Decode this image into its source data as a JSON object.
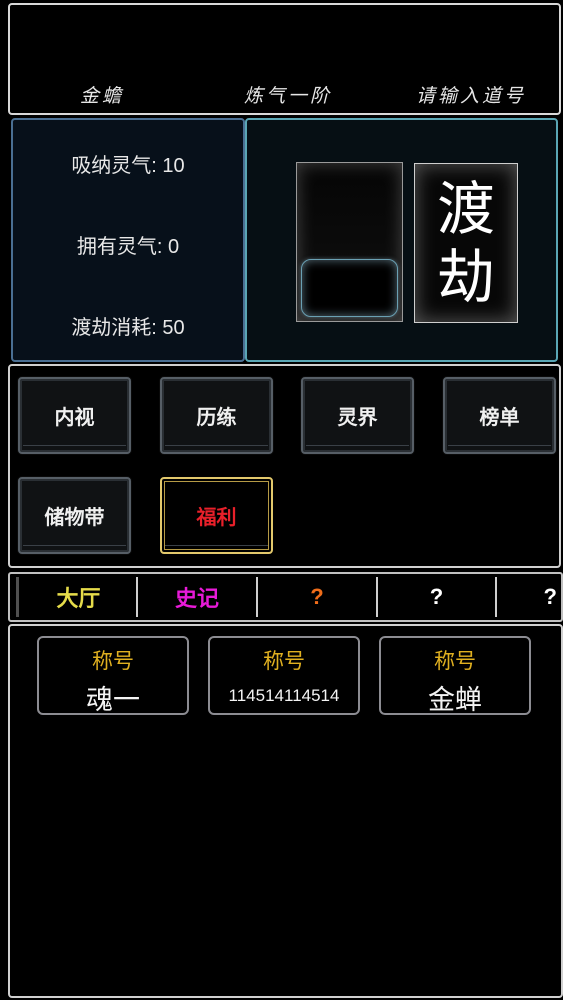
{
  "header": {
    "name": "金蟾",
    "realm": "炼气一阶",
    "dao_id": "请输入道号"
  },
  "stats": {
    "absorb": "吸纳灵气: 10",
    "owned": "拥有灵气: 0",
    "tribulation_cost": "渡劫消耗: 50"
  },
  "tribulation": {
    "progress": 0.42,
    "button_char1": "渡",
    "button_char2": "劫"
  },
  "menu": {
    "items": [
      "内视",
      "历练",
      "灵界",
      "榜单",
      "储物带",
      "福利"
    ]
  },
  "tabs": {
    "items": [
      "大厅",
      "史记",
      "?",
      "?",
      "?"
    ]
  },
  "cards": [
    {
      "label": "称号",
      "value": "魂一"
    },
    {
      "label": "称号",
      "value": "114514114514"
    },
    {
      "label": "称号",
      "value": "金蝉"
    }
  ],
  "colors": {
    "tab_active": "#e6dc4a",
    "tab_history": "#e81ad8",
    "tab_unknown": "#ef6d1a",
    "welfare_text": "#e8202a",
    "welfare_border": "#e2c86c",
    "card_label": "#e0b020"
  }
}
